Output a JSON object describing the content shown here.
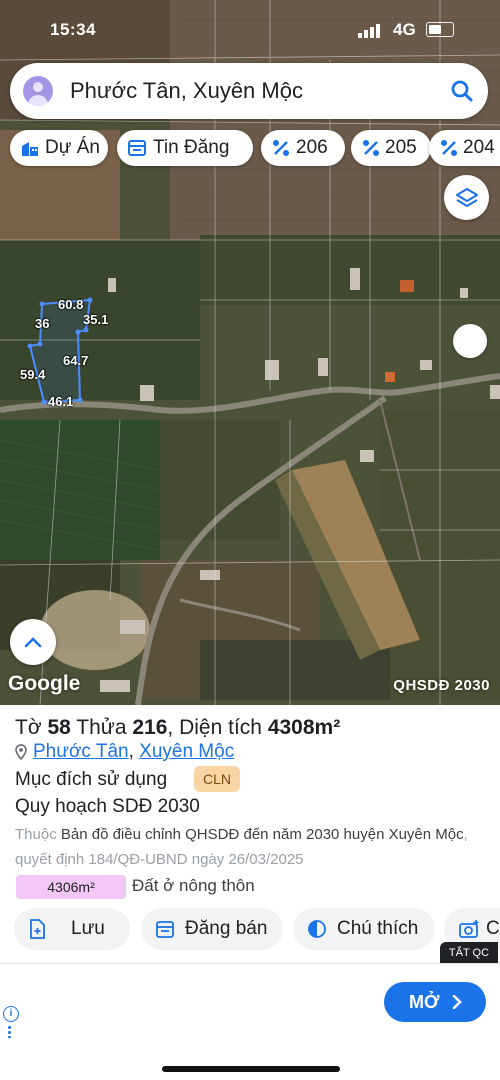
{
  "status": {
    "time": "15:34",
    "network": "4G"
  },
  "search": {
    "query": "Phước Tân, Xuyên Mộc"
  },
  "chips": [
    {
      "icon": "building-icon",
      "label": "Dự Án"
    },
    {
      "icon": "listing-icon",
      "label": "Tin Đăng"
    },
    {
      "icon": "percent-icon",
      "label": "206"
    },
    {
      "icon": "percent-icon",
      "label": "205"
    },
    {
      "icon": "percent-icon",
      "label": "204"
    }
  ],
  "parcel_dimensions": [
    "60.8",
    "36",
    "35.1",
    "64.7",
    "59.4",
    "46.1"
  ],
  "map": {
    "attribution": "Google",
    "layer_label": "QHSDĐ 2030"
  },
  "parcel": {
    "sheet_label": "Tờ",
    "sheet_no": "58",
    "lot_label": "Thửa",
    "lot_no": "216",
    "area_label": "Diện tích",
    "area": "4308m²",
    "commune": "Phước Tân",
    "district": "Xuyên Mộc",
    "purpose_label": "Mục đích sử dụng",
    "purpose_code": "CLN",
    "plan_title": "Quy hoạch SDĐ 2030",
    "desc_prefix": "Thuộc",
    "desc_plan": "Bản đồ điều chỉnh QHSDĐ đến năm 2030 huyện Xuyên Mộc",
    "desc_suffix": ", quyết định 184/QĐ-UBND ngày 26/03/2025",
    "zone_area": "4306m²",
    "zone_label": "Đất ở nông thôn",
    "zone_color": "#f3c7f5"
  },
  "actions": {
    "save": "Lưu",
    "post": "Đăng bán",
    "legend": "Chú thích",
    "capture": "C"
  },
  "ad": {
    "close_label": "TẮT QC",
    "open_label": "MỞ"
  },
  "colors": {
    "accent": "#1a73e8",
    "badge": "#f8d4a4"
  }
}
